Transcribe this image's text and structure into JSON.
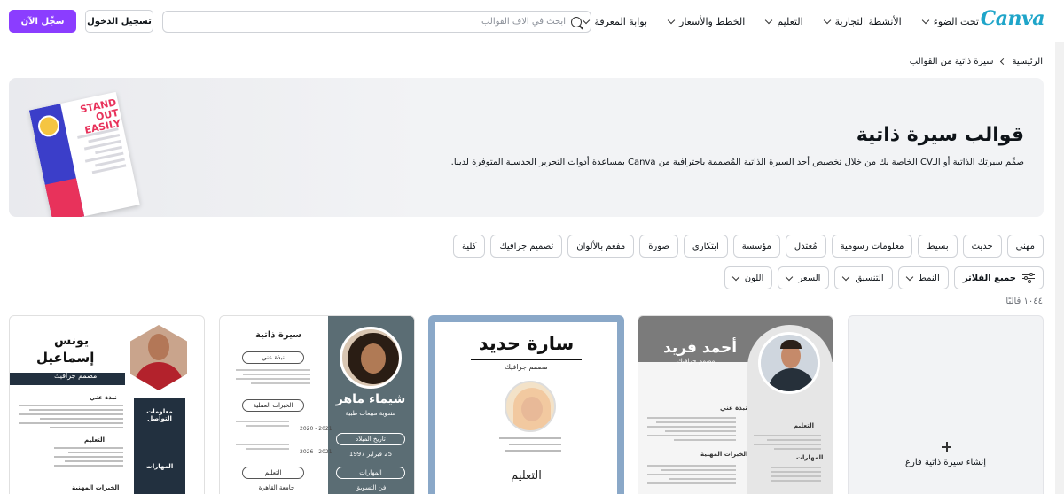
{
  "header": {
    "logo": "Canva",
    "nav": [
      {
        "label": "تحت الضوء"
      },
      {
        "label": "الأنشطة التجارية"
      },
      {
        "label": "التعليم"
      },
      {
        "label": "الخطط والأسعار"
      },
      {
        "label": "بوابة المعرفة"
      }
    ],
    "search_placeholder": "ابحث في آلاف القوالب",
    "login_label": "تسجيل الدخول",
    "signup_label": "سجِّل الآن"
  },
  "breadcrumb": {
    "home": "الرئيسية",
    "current": "سيرة ذاتية من القوالب"
  },
  "hero": {
    "title": "قوالب سيرة ذاتية",
    "description": "صمِّم سيرتك الذاتية أو الـCV الخاصة بك من خلال تخصيص أحد السيرة الذاتية المُصممة باحترافية من Canva بمساعدة أدوات التحرير الحدسية المتوفرة لدينا.",
    "art_headline": "STAND OUT EASILY"
  },
  "chips": [
    "مهني",
    "حديث",
    "بسيط",
    "معلومات رسومية",
    "مُعتدل",
    "مؤسسة",
    "ابتكاري",
    "صورة",
    "مفعم بالألوان",
    "تصميم جرافيك",
    "كلية"
  ],
  "filters": {
    "all": "جميع الفلاتر",
    "style": "النمط",
    "format": "التنسيق",
    "price": "السعر",
    "color": "اللون"
  },
  "count": "١٠٤٤ قالبًا",
  "colors": {
    "accent": "#8b3dff",
    "logo": "#1fa5c9"
  },
  "templates": {
    "create_blank": "إنشاء سيرة ذاتية فارغ",
    "ahmed": {
      "name": "أحمد فريد",
      "title": "مصمم جرافيك",
      "about": "نبذة عني",
      "education": "التعليم",
      "experience": "الخبرات المهنية",
      "skills": "المهارات"
    },
    "sara": {
      "name": "سارة حديد",
      "title": "مصمم جرافيك",
      "education": "التعليم"
    },
    "shaimaa": {
      "heading": "سيرة ذاتية",
      "name": "شيماء ماهر",
      "title": "مندوبة مبيعات طبية",
      "about": "نبذة عني",
      "experience": "الخبرات العملية",
      "education": "التعليم",
      "university": "جامعة القاهرة",
      "years1": "2021 - 2020",
      "years2": "2021 - 2026",
      "birth_label": "تاريخ الميلاد",
      "birth_date": "25 فبراير 1997",
      "skills": "المهارات",
      "marketing": "فن التسويق"
    },
    "younes": {
      "first_name": "يونس",
      "last_name": "إسماعيل",
      "title": "مصمم جرافيك",
      "contact": "معلومات التواصل",
      "about": "نبذة عني",
      "education": "التعليم",
      "skills": "المهارات",
      "experience": "الخبرات المهنية"
    }
  }
}
